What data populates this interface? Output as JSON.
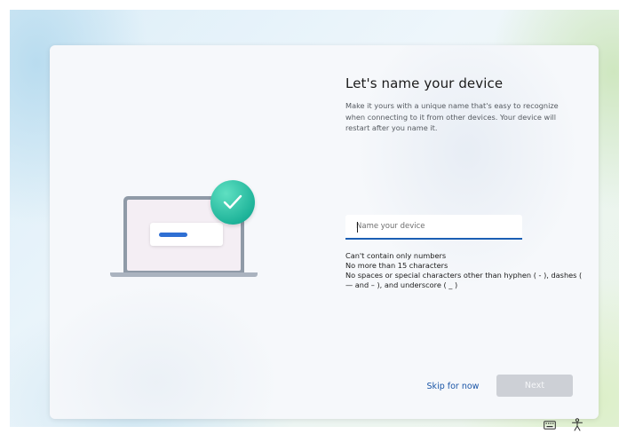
{
  "page": {
    "title": "Let's name your device",
    "description": "Make it yours with a unique name that's easy to recognize when connecting to it from other devices. Your device will restart after you name it."
  },
  "name_input": {
    "value": "",
    "placeholder": "Name your device"
  },
  "rules": [
    "Can't contain only numbers",
    "No more than 15 characters",
    "No spaces or special characters other than hyphen ( - ), dashes ( — and – ), and underscore ( _ )"
  ],
  "buttons": {
    "skip_label": "Skip for now",
    "next_label": "Next",
    "next_enabled": false
  },
  "illustration": {
    "icons": [
      "laptop-icon",
      "checkmark-icon"
    ]
  },
  "tray": {
    "icons": [
      "keyboard-icon",
      "accessibility-icon"
    ]
  },
  "colors": {
    "accent": "#1b5fb4",
    "link": "#1a55a6",
    "check_badge": "#1fb49a",
    "disabled_button": "#cdd0d6"
  }
}
